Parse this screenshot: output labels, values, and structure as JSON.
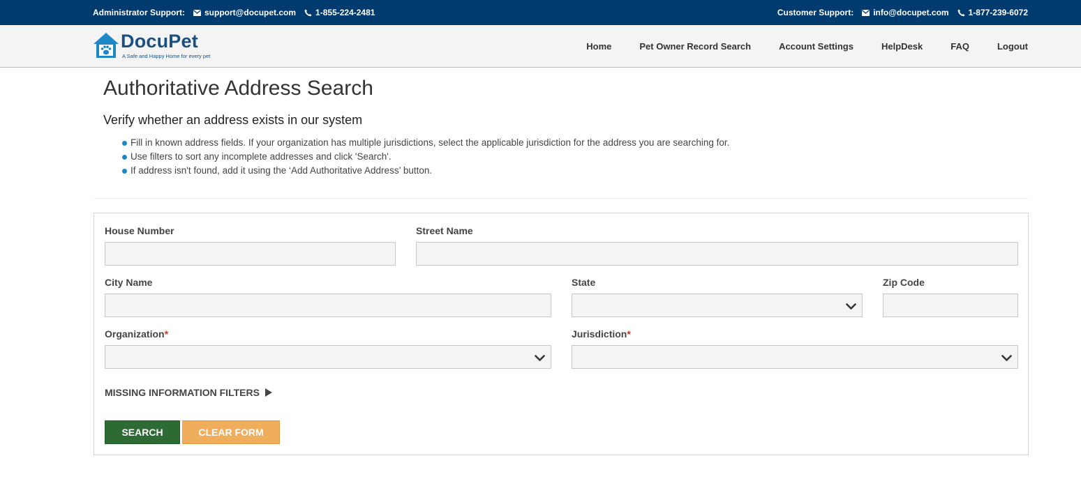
{
  "topbar": {
    "admin_label": "Administrator Support:",
    "admin_email": "support@docupet.com",
    "admin_phone": "1-855-224-2481",
    "customer_label": "Customer Support:",
    "customer_email": "info@docupet.com",
    "customer_phone": "1-877-239-6072",
    "icons": [
      "envelope-icon",
      "phone-icon"
    ]
  },
  "logo": {
    "brand": "DocuPet",
    "tagline": "A Safe and Happy Home for every pet"
  },
  "nav": {
    "items": [
      "Home",
      "Pet Owner Record Search",
      "Account Settings",
      "HelpDesk",
      "FAQ",
      "Logout"
    ]
  },
  "page": {
    "title": "Authoritative Address Search",
    "subtitle": "Verify whether an address exists in our system",
    "bullets": [
      "Fill in known address fields. If your organization has multiple jurisdictions, select the applicable jurisdiction for the address you are searching for.",
      "Use filters to sort any incomplete addresses and click 'Search'.",
      "If address isn't found, add it using the ‘Add Authoritative Address’ button."
    ]
  },
  "form": {
    "house_number": {
      "label": "House Number",
      "value": ""
    },
    "street_name": {
      "label": "Street Name",
      "value": ""
    },
    "city_name": {
      "label": "City Name",
      "value": ""
    },
    "state": {
      "label": "State",
      "value": ""
    },
    "zip_code": {
      "label": "Zip Code",
      "value": ""
    },
    "organization": {
      "label": "Organization",
      "required_mark": "*",
      "value": ""
    },
    "jurisdiction": {
      "label": "Jurisdiction",
      "required_mark": "*",
      "value": ""
    },
    "filters_label": "MISSING INFORMATION FILTERS",
    "search_button": "Search",
    "clear_button": "Clear Form"
  },
  "colors": {
    "topbar_bg": "#003b6f",
    "brand_blue": "#1b4f7f",
    "bullet_blue": "#1e88c7",
    "search_green": "#2e6b34",
    "clear_orange": "#f0ad5c",
    "required_red": "#c0392b"
  }
}
